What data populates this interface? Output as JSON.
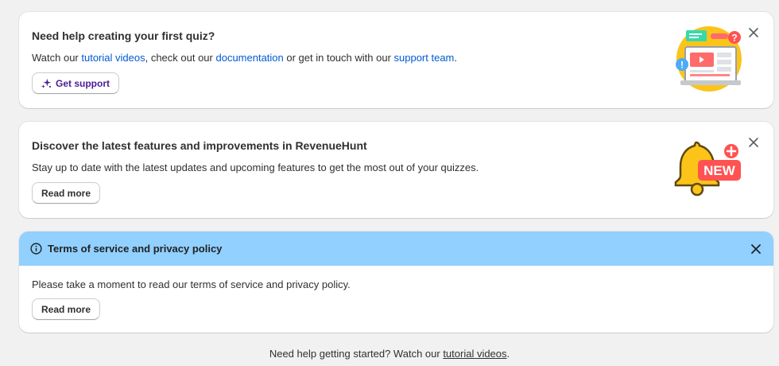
{
  "quiz_help": {
    "title": "Need help creating your first quiz?",
    "text_1": "Watch our ",
    "link_tutorial": "tutorial videos",
    "text_2": ", check out our ",
    "link_docs": "documentation",
    "text_3": " or get in touch with our ",
    "link_support": "support team",
    "text_4": ".",
    "button_label": "Get support",
    "button_icon": "sparkle-icon",
    "close_icon": "close-icon"
  },
  "features": {
    "title": "Discover the latest features and improvements in RevenueHunt",
    "text": "Stay up to date with the latest updates and upcoming features to get the most out of your quizzes.",
    "button_label": "Read more",
    "badge_text": "NEW",
    "close_icon": "close-icon"
  },
  "terms": {
    "title": "Terms of service and privacy policy",
    "text": "Please take a moment to read our terms of service and privacy policy.",
    "button_label": "Read more",
    "info_icon": "info-icon",
    "close_icon": "close-icon"
  },
  "footer": {
    "text": "Need help getting started? Watch our ",
    "link": "tutorial videos",
    "suffix": "."
  },
  "colors": {
    "page_bg": "#f1f1f1",
    "link": "#005bd3",
    "banner_bg": "#91d0ff",
    "support_button_text": "#4a1c96"
  }
}
